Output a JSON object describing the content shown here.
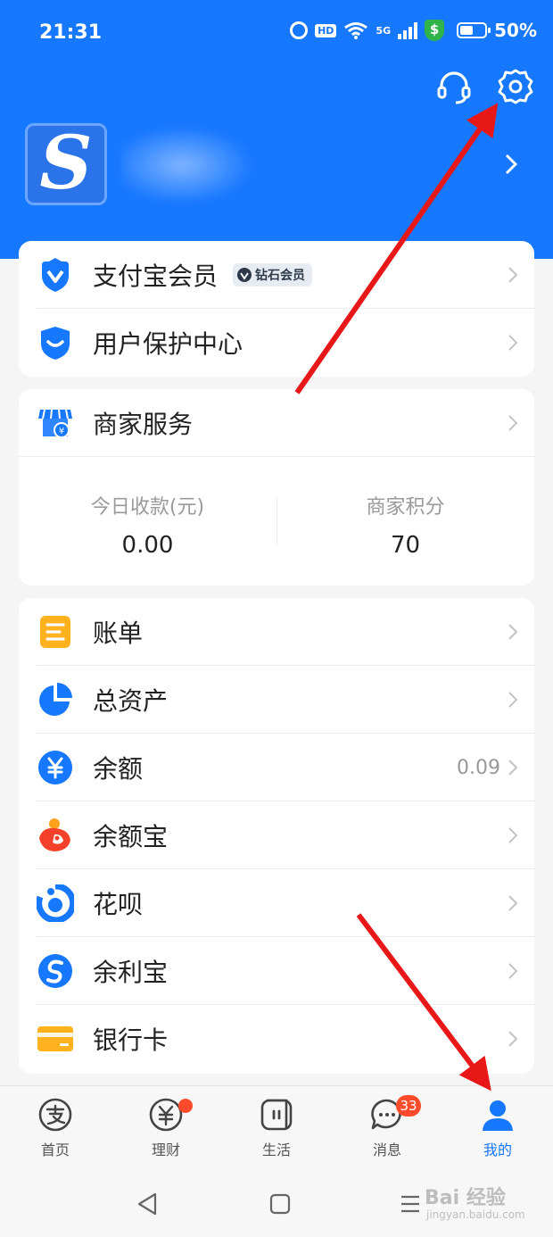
{
  "status_bar": {
    "time": "21:31",
    "hd_label": "HD",
    "network_label": "5G",
    "battery_pct": "50%",
    "battery_level": 0.5
  },
  "header": {
    "background": "#1677ff",
    "avatar_letter": "S"
  },
  "membership_card": {
    "items": [
      {
        "label": "支付宝会员",
        "badge": "钻石会员",
        "icon": "shield-v-icon"
      },
      {
        "label": "用户保护中心",
        "icon": "user-protection-icon"
      }
    ]
  },
  "merchant_card": {
    "label": "商家服务",
    "icon": "store-icon",
    "stats": [
      {
        "label": "今日收款(元)",
        "value": "0.00"
      },
      {
        "label": "商家积分",
        "value": "70"
      }
    ]
  },
  "menu_card": {
    "items": [
      {
        "label": "账单",
        "icon": "bill-icon",
        "value": ""
      },
      {
        "label": "总资产",
        "icon": "pie-chart-icon",
        "value": ""
      },
      {
        "label": "余额",
        "icon": "yuan-coin-icon",
        "value": "0.09"
      },
      {
        "label": "余额宝",
        "icon": "yuebao-icon",
        "value": ""
      },
      {
        "label": "花呗",
        "icon": "huabei-icon",
        "value": ""
      },
      {
        "label": "余利宝",
        "icon": "yulibao-icon",
        "value": ""
      },
      {
        "label": "银行卡",
        "icon": "bank-card-icon",
        "value": ""
      }
    ]
  },
  "tab_bar": {
    "tabs": [
      {
        "label": "首页",
        "icon": "alipay-logo-icon",
        "active": false
      },
      {
        "label": "理财",
        "icon": "wealth-icon",
        "active": false,
        "dot": true
      },
      {
        "label": "生活",
        "icon": "life-icon",
        "active": false
      },
      {
        "label": "消息",
        "icon": "message-icon",
        "active": false,
        "count": "33"
      },
      {
        "label": "我的",
        "icon": "profile-icon",
        "active": true
      }
    ]
  },
  "watermark": {
    "main": "Bai 经验",
    "sub": "jingyan.baidu.com"
  },
  "colors": {
    "accent": "#1677ff",
    "annotation_arrow": "#e81818",
    "badge_red": "#ff4b2b"
  }
}
